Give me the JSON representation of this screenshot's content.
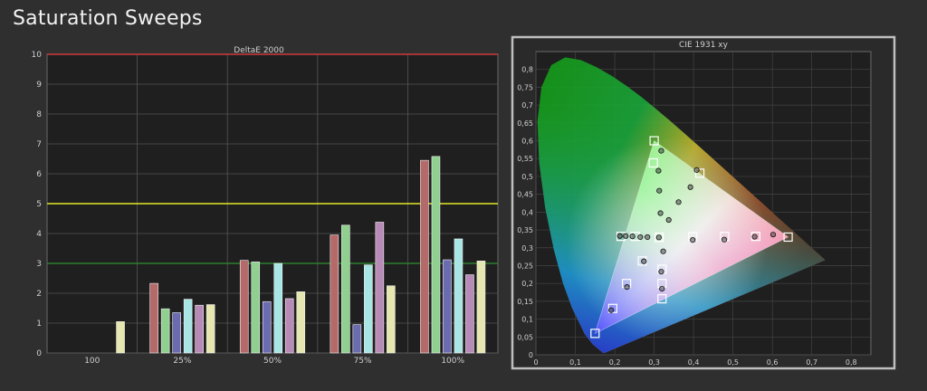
{
  "page_title": "Saturation Sweeps",
  "chart_data": [
    {
      "type": "bar",
      "title": "DeltaE 2000",
      "categories": [
        "100",
        "25%",
        "50%",
        "75%",
        "100%"
      ],
      "ylim": [
        0,
        10
      ],
      "yticks": [
        0,
        1,
        2,
        3,
        4,
        5,
        6,
        7,
        8,
        9,
        10
      ],
      "grid": true,
      "reference_lines": [
        {
          "value": 10,
          "color": "#d03a3a"
        },
        {
          "value": 5,
          "color": "#e6e62a"
        },
        {
          "value": 3,
          "color": "#2e7d2e"
        }
      ],
      "series": [
        {
          "color": "#b56a6a",
          "values": [
            null,
            2.33,
            3.1,
            3.95,
            6.45
          ]
        },
        {
          "color": "#8fd08f",
          "values": [
            null,
            1.48,
            3.05,
            4.28,
            6.58
          ]
        },
        {
          "color": "#6b6bb0",
          "values": [
            null,
            1.35,
            1.72,
            0.95,
            3.12
          ]
        },
        {
          "color": "#a8e6e6",
          "values": [
            null,
            1.8,
            3.0,
            2.95,
            3.82
          ]
        },
        {
          "color": "#b88ab8",
          "values": [
            null,
            1.6,
            1.82,
            4.38,
            2.62
          ]
        },
        {
          "color": "#e6e6b0",
          "values": [
            1.05,
            1.62,
            2.05,
            2.25,
            3.08
          ]
        }
      ]
    },
    {
      "type": "scatter",
      "title": "CIE 1931 xy",
      "xlim": [
        0,
        0.85
      ],
      "ylim": [
        0,
        0.85
      ],
      "xticks": [
        "0",
        "0,1",
        "0,2",
        "0,3",
        "0,4",
        "0,5",
        "0,6",
        "0,7",
        "0,8"
      ],
      "yticks": [
        "0",
        "0,05",
        "0,1",
        "0,15",
        "0,2",
        "0,25",
        "0,3",
        "0,35",
        "0,4",
        "0,45",
        "0,5",
        "0,55",
        "0,6",
        "0,65",
        "0,7",
        "0,75",
        "0,8"
      ],
      "gamut_triangle": [
        [
          0.64,
          0.33
        ],
        [
          0.3,
          0.6
        ],
        [
          0.15,
          0.06
        ]
      ],
      "targets": [
        [
          0.3127,
          0.329
        ],
        [
          0.3127,
          0.329
        ],
        [
          0.398,
          0.331
        ],
        [
          0.479,
          0.332
        ],
        [
          0.558,
          0.332
        ],
        [
          0.64,
          0.33
        ],
        [
          0.298,
          0.538
        ],
        [
          0.3,
          0.6
        ],
        [
          0.416,
          0.509
        ],
        [
          0.252,
          0.332
        ],
        [
          0.216,
          0.332
        ],
        [
          0.23,
          0.2
        ],
        [
          0.195,
          0.13
        ],
        [
          0.15,
          0.06
        ],
        [
          0.32,
          0.24
        ],
        [
          0.32,
          0.2
        ],
        [
          0.32,
          0.157
        ],
        [
          0.27,
          0.263
        ]
      ],
      "measured": [
        [
          0.312,
          0.329
        ],
        [
          0.323,
          0.29
        ],
        [
          0.283,
          0.33
        ],
        [
          0.265,
          0.33
        ],
        [
          0.245,
          0.332
        ],
        [
          0.228,
          0.333
        ],
        [
          0.213,
          0.333
        ],
        [
          0.398,
          0.322
        ],
        [
          0.478,
          0.323
        ],
        [
          0.555,
          0.331
        ],
        [
          0.602,
          0.337
        ],
        [
          0.318,
          0.572
        ],
        [
          0.311,
          0.516
        ],
        [
          0.313,
          0.46
        ],
        [
          0.316,
          0.397
        ],
        [
          0.337,
          0.378
        ],
        [
          0.362,
          0.428
        ],
        [
          0.392,
          0.47
        ],
        [
          0.408,
          0.518
        ],
        [
          0.231,
          0.19
        ],
        [
          0.191,
          0.125
        ],
        [
          0.274,
          0.262
        ],
        [
          0.32,
          0.185
        ],
        [
          0.318,
          0.233
        ]
      ]
    }
  ]
}
